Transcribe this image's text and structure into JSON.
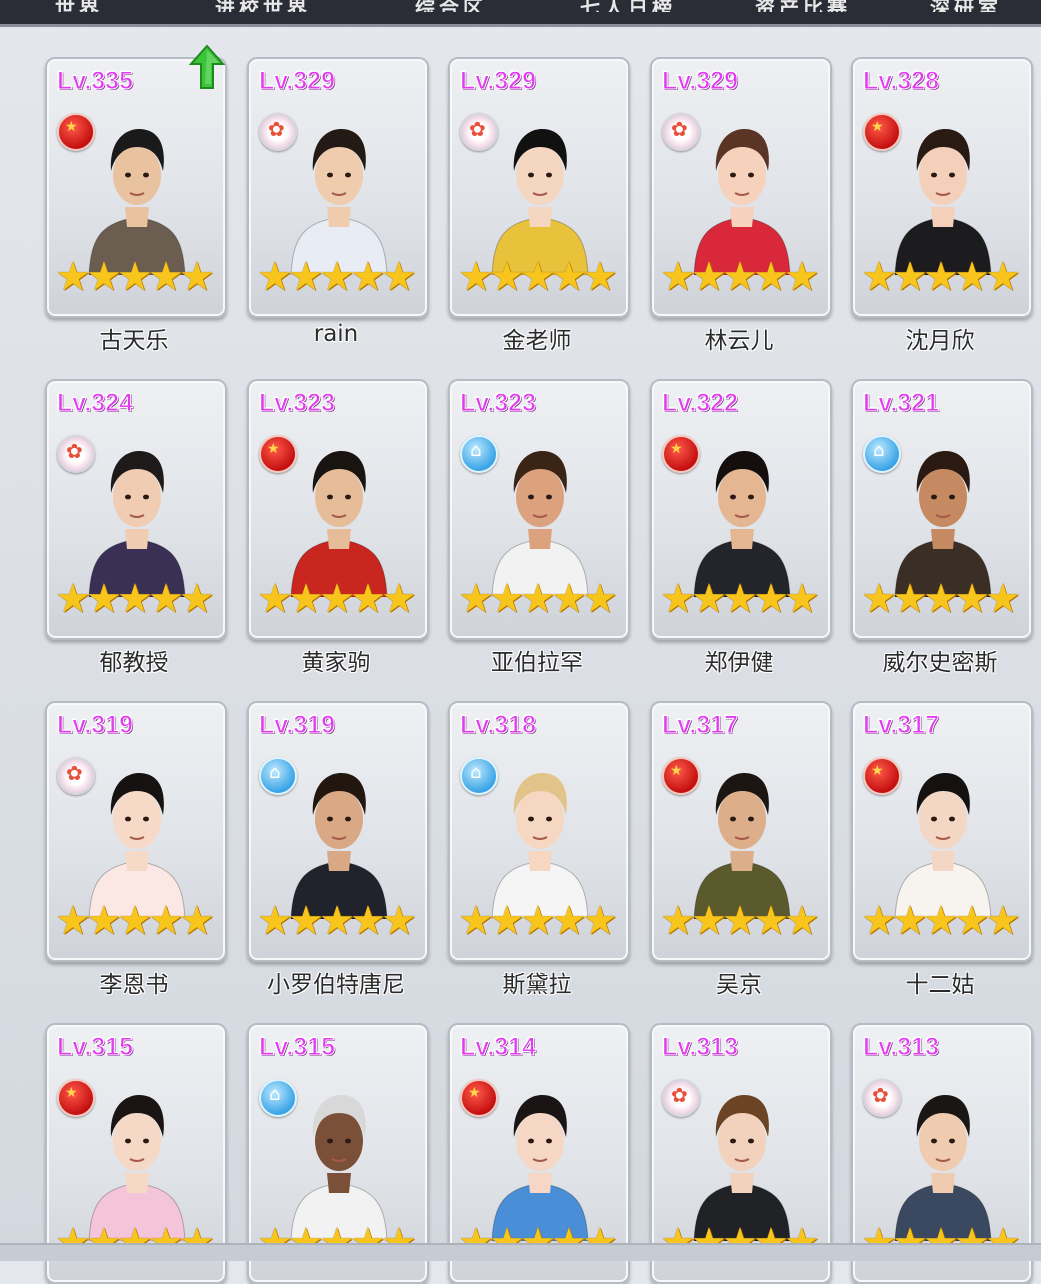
{
  "top_tabs": [
    "世界",
    "进校世界",
    "综合区",
    "七人日榜",
    "资产比赛",
    "深研室"
  ],
  "colors": {
    "level_text": "#e13cf0",
    "star": "#f7c51b",
    "arrow": "#3cc43a"
  },
  "characters": [
    {
      "level": "Lv.335",
      "name": "古天乐",
      "badge": "red",
      "hair": "#1a1a1a",
      "skin": "#e9c2a0",
      "outfit": "#6b5d50"
    },
    {
      "level": "Lv.329",
      "name": "rain",
      "badge": "flower",
      "hair": "#231a15",
      "skin": "#f0ccae",
      "outfit": "#e8ecf5"
    },
    {
      "level": "Lv.329",
      "name": "金老师",
      "badge": "flower",
      "hair": "#111111",
      "skin": "#f5d6c0",
      "outfit": "#e8c23a"
    },
    {
      "level": "Lv.329",
      "name": "林云儿",
      "badge": "flower",
      "hair": "#5a3424",
      "skin": "#f6d2bc",
      "outfit": "#d8283a"
    },
    {
      "level": "Lv.328",
      "name": "沈月欣",
      "badge": "red",
      "hair": "#2a1a14",
      "skin": "#f4d0ba",
      "outfit": "#1c1c1f"
    },
    {
      "level": "Lv.324",
      "name": "郁教授",
      "badge": "flower",
      "hair": "#1e1a1a",
      "skin": "#f0cdb2",
      "outfit": "#3a2f55"
    },
    {
      "level": "Lv.323",
      "name": "黄家驹",
      "badge": "red",
      "hair": "#1a1410",
      "skin": "#e6bd98",
      "outfit": "#c8261f"
    },
    {
      "level": "Lv.323",
      "name": "亚伯拉罕",
      "badge": "blue",
      "hair": "#3a2416",
      "skin": "#dca27e",
      "outfit": "#f2f2f2"
    },
    {
      "level": "Lv.322",
      "name": "郑伊健",
      "badge": "red",
      "hair": "#140f0c",
      "skin": "#e4b692",
      "outfit": "#23252b"
    },
    {
      "level": "Lv.321",
      "name": "威尔史密斯",
      "badge": "blue",
      "hair": "#2a1a12",
      "skin": "#c58a62",
      "outfit": "#3a2e25"
    },
    {
      "level": "Lv.319",
      "name": "李恩书",
      "badge": "flower",
      "hair": "#161212",
      "skin": "#f7d9c8",
      "outfit": "#fbe8e4"
    },
    {
      "level": "Lv.319",
      "name": "小罗伯特唐尼",
      "badge": "blue",
      "hair": "#22170f",
      "skin": "#d9a884",
      "outfit": "#20232c"
    },
    {
      "level": "Lv.318",
      "name": "斯黛拉",
      "badge": "blue",
      "hair": "#e1c48a",
      "skin": "#f5d7c2",
      "outfit": "#f5f5f5"
    },
    {
      "level": "Lv.317",
      "name": "吴京",
      "badge": "red",
      "hair": "#1c1612",
      "skin": "#dcae8a",
      "outfit": "#5a5a2c"
    },
    {
      "level": "Lv.317",
      "name": "十二姑",
      "badge": "red",
      "hair": "#151111",
      "skin": "#f4d6c4",
      "outfit": "#f7f3ef"
    },
    {
      "level": "Lv.315",
      "name": "",
      "badge": "red",
      "hair": "#1a1414",
      "skin": "#f6d8c6",
      "outfit": "#f4c4d8"
    },
    {
      "level": "Lv.315",
      "name": "",
      "badge": "blue",
      "hair": "#d8d8d8",
      "skin": "#7a5038",
      "outfit": "#f2f2f2"
    },
    {
      "level": "Lv.314",
      "name": "",
      "badge": "red",
      "hair": "#1a1414",
      "skin": "#f6d6c4",
      "outfit": "#4a8ed8"
    },
    {
      "level": "Lv.313",
      "name": "",
      "badge": "flower",
      "hair": "#6a4424",
      "skin": "#f2d2bc",
      "outfit": "#202226"
    },
    {
      "level": "Lv.313",
      "name": "",
      "badge": "flower",
      "hair": "#1a1614",
      "skin": "#efcbb0",
      "outfit": "#3a4860"
    }
  ]
}
